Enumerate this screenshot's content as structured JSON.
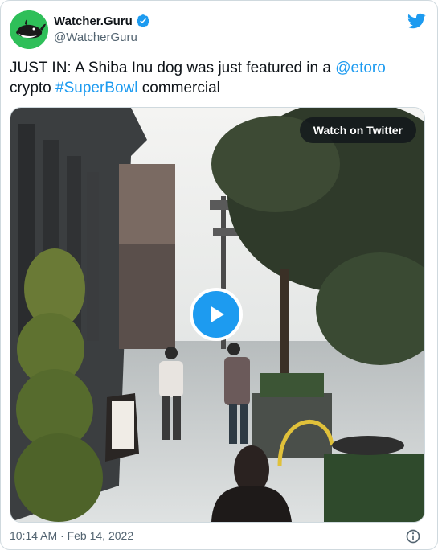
{
  "author": {
    "display_name": "Watcher.Guru",
    "handle": "@WatcherGuru",
    "avatar_icon": "whale-logo-icon",
    "verified_icon": "verified-badge-icon"
  },
  "tweet": {
    "text_part1": "JUST IN: A Shiba Inu dog was just featured in a ",
    "mention": "@etoro",
    "text_part2": "crypto ",
    "hashtag": "#SuperBowl",
    "text_part3": " commercial"
  },
  "media": {
    "watch_label": "Watch on Twitter",
    "play_icon": "play-icon"
  },
  "footer": {
    "timestamp": "10:14 AM · Feb 14, 2022",
    "info_icon": "info-icon"
  },
  "colors": {
    "accent": "#1d9bf0",
    "avatar_bg": "#2fbf59",
    "text": "#0f1419",
    "muted": "#536471"
  }
}
